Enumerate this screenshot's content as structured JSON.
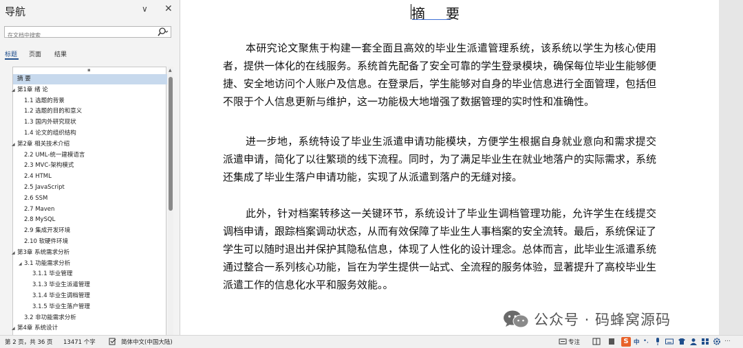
{
  "nav": {
    "title": "导航",
    "search_placeholder": "在文档中搜索",
    "tabs": [
      "标题",
      "页面",
      "结果"
    ],
    "tree": [
      {
        "label": "摘  要",
        "level": 1,
        "selected": true,
        "arrow": ""
      },
      {
        "label": "第1章  绪  论",
        "level": 1,
        "arrow": "◢"
      },
      {
        "label": "1.1  选题的背景",
        "level": 2,
        "arrow": ""
      },
      {
        "label": "1.2  选题的目的和意义",
        "level": 2,
        "arrow": ""
      },
      {
        "label": "1.3  国内外研究现状",
        "level": 2,
        "arrow": ""
      },
      {
        "label": "1.4  论文的组织结构",
        "level": 2,
        "arrow": ""
      },
      {
        "label": "第2章  相关技术介绍",
        "level": 1,
        "arrow": "◢"
      },
      {
        "label": "2.2  UML-统一建模语言",
        "level": 2,
        "arrow": ""
      },
      {
        "label": "2.3  MVC-架构模式",
        "level": 2,
        "arrow": ""
      },
      {
        "label": "2.4  HTML",
        "level": 2,
        "arrow": ""
      },
      {
        "label": "2.5  JavaScript",
        "level": 2,
        "arrow": ""
      },
      {
        "label": "2.6 SSM",
        "level": 2,
        "arrow": ""
      },
      {
        "label": "2.7  Maven",
        "level": 2,
        "arrow": ""
      },
      {
        "label": "2.8  MySQL",
        "level": 2,
        "arrow": ""
      },
      {
        "label": "2.9  集成开发环境",
        "level": 2,
        "arrow": ""
      },
      {
        "label": "2.10  软硬件环境",
        "level": 2,
        "arrow": ""
      },
      {
        "label": "第3章 系统需求分析",
        "level": 1,
        "arrow": "◢"
      },
      {
        "label": "3.1  功能需求分析",
        "level": 2,
        "arrow": "◢"
      },
      {
        "label": "3.1.1  毕业管理",
        "level": 3,
        "arrow": ""
      },
      {
        "label": "3.1.3  毕业生派遣管理",
        "level": 3,
        "arrow": ""
      },
      {
        "label": "3.1.4  毕业生调档管理",
        "level": 3,
        "arrow": ""
      },
      {
        "label": "3.1.5  毕业生落户管理",
        "level": 3,
        "arrow": ""
      },
      {
        "label": "3.2  非功能需求分析",
        "level": 2,
        "arrow": ""
      },
      {
        "label": "第4章  系统设计",
        "level": 1,
        "arrow": "◢"
      }
    ]
  },
  "document": {
    "title": "摘要",
    "paragraphs": [
      "本研究论文聚焦于构建一套全面且高效的毕业生派遣管理系统，该系统以学生为核心使用者，提供一体化的在线服务。系统首先配备了安全可靠的学生登录模块，确保每位毕业生能够便捷、安全地访问个人账户及信息。在登录后，学生能够对自身的毕业信息进行全面管理，包括但不限于个人信息更新与维护，这一功能极大地增强了数据管理的实时性和准确性。",
      "进一步地，系统特设了毕业生派遣申请功能模块，方便学生根据自身就业意向和需求提交派遣申请，简化了以往繁琐的线下流程。同时，为了满足毕业生在就业地落户的实际需求，系统还集成了毕业生落户申请功能，实现了从派遣到落户的无缝对接。",
      "此外，针对档案转移这一关键环节，系统设计了毕业生调档管理功能，允许学生在线提交调档申请，跟踪档案调动状态，从而有效保障了毕业生人事档案的安全流转。最后，系统保证了学生可以随时退出并保护其隐私信息，体现了人性化的设计理念。总体而言，此毕业生派遣系统通过整合一系列核心功能，旨在为学生提供一站式、全流程的服务体验，显著提升了高校毕业生派遣工作的信息化水平和服务效能。。"
    ]
  },
  "watermark": {
    "text": "公众号 · 码蜂窝源码"
  },
  "status": {
    "page": "第 2 页，共 36 页",
    "words": "13471 个字",
    "language": "简体中文(中国大陆)",
    "focus": "专注"
  },
  "colors": {
    "accent": "#1f4e8c",
    "selection": "#c7d9ed",
    "ime": "#e8622a"
  }
}
